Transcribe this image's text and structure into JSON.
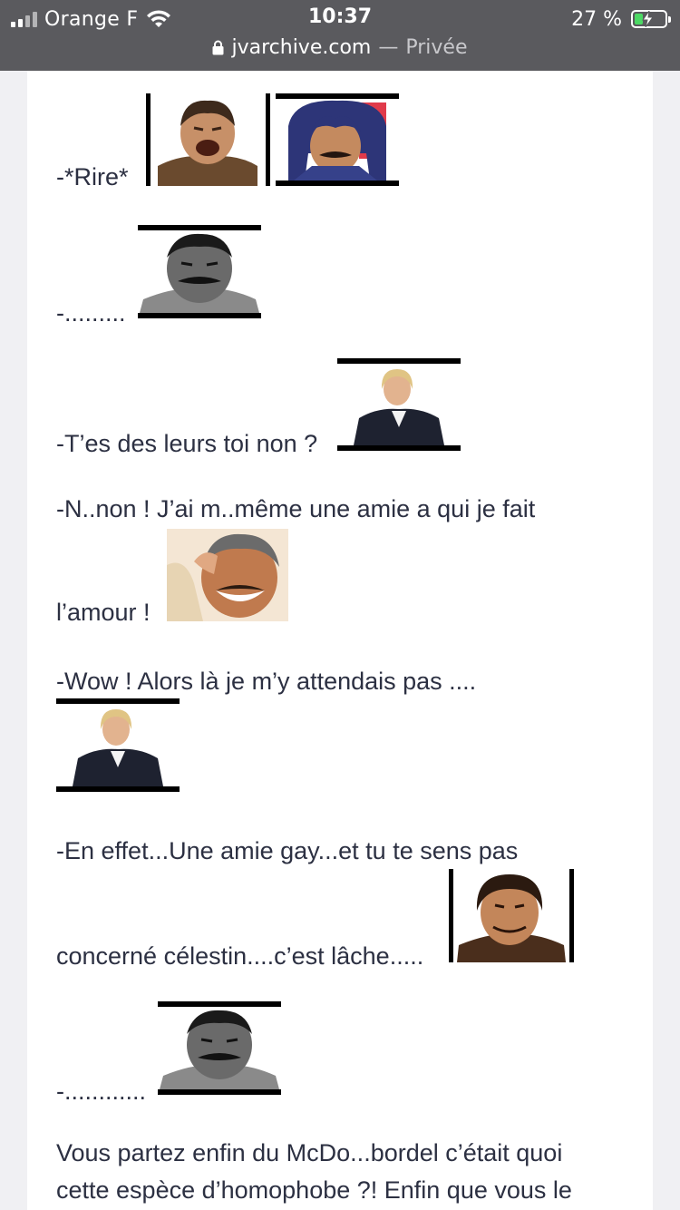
{
  "status_bar": {
    "carrier": "Orange F",
    "time": "10:37",
    "battery_percent": "27 %",
    "battery_level": 0.27,
    "signal_bars": 2,
    "icons": [
      "signal-icon",
      "wifi-icon",
      "battery-charging-icon"
    ]
  },
  "browser": {
    "url": "jvarchive.com",
    "separator": "—",
    "mode": "Privée",
    "icons": [
      "lock-icon"
    ]
  },
  "post": {
    "lines": [
      "-*Rire*",
      "-.........",
      "-T’es des leurs toi non ?",
      "-N..non ! J’ai m..même une amie a qui je fait",
      "l’amour !",
      "-Wow ! Alors là je m’y attendais pas ....",
      "-En effet...Une amie gay...et tu te sens pas",
      "concerné célestin....c’est lâche.....",
      "-............",
      "Vous partez enfin du McDo...bordel c’était quoi",
      "cette espèce d’homophobe ?! Enfin que vous le"
    ],
    "stickers": [
      "laughing-man-sticker",
      "anime-hair-man-sticker",
      "risitas-serious-sticker",
      "blonde-woman-sticker",
      "risitas-laughing-sticker",
      "blonde-woman-sticker",
      "smirking-man-sticker",
      "risitas-serious-sticker"
    ]
  },
  "colors": {
    "status_bar_bg": "#5a5a5e",
    "page_bg": "#f0f0f3",
    "text": "#2c3042",
    "battery_green": "#4cd964"
  }
}
